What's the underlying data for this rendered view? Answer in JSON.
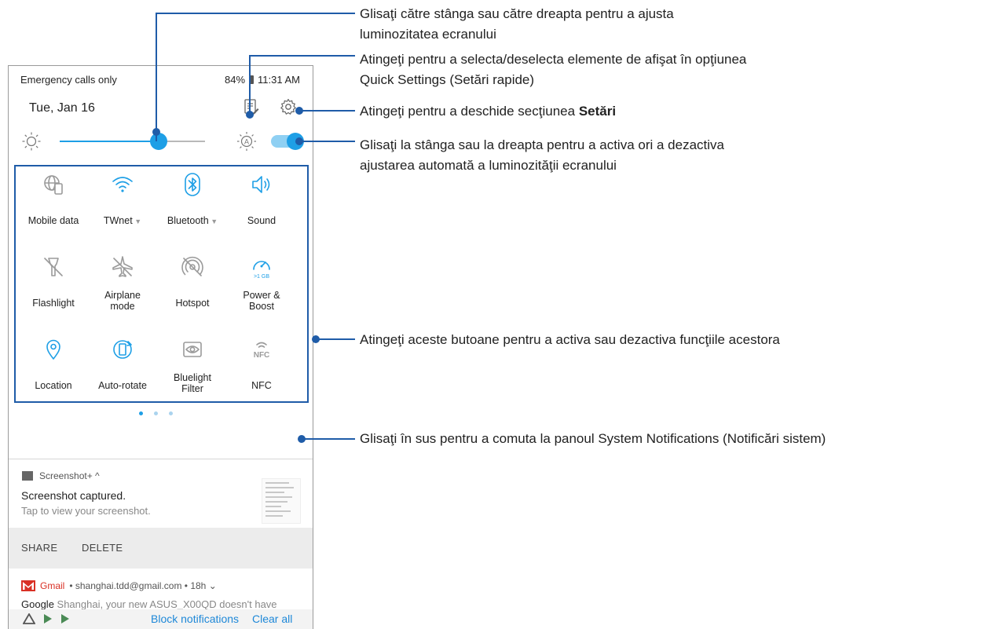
{
  "status": {
    "left": "Emergency calls only",
    "battery": "84%",
    "time": "11:31 AM"
  },
  "header": {
    "date": "Tue, Jan 16"
  },
  "brightness": {
    "level": 0.68,
    "auto": true
  },
  "tiles": [
    {
      "label1": "Mobile data",
      "label2": "",
      "caret": false,
      "icon": "globe-phone-icon",
      "active": false
    },
    {
      "label1": "TWnet",
      "label2": "",
      "caret": true,
      "icon": "wifi-icon",
      "active": true
    },
    {
      "label1": "Bluetooth",
      "label2": "",
      "caret": true,
      "icon": "bluetooth-icon",
      "active": true
    },
    {
      "label1": "Sound",
      "label2": "",
      "caret": false,
      "icon": "speaker-icon",
      "active": true
    },
    {
      "label1": "Flashlight",
      "label2": "",
      "caret": false,
      "icon": "flashlight-icon",
      "active": false
    },
    {
      "label1": "Airplane",
      "label2": "mode",
      "caret": false,
      "icon": "airplane-icon",
      "active": false
    },
    {
      "label1": "Hotspot",
      "label2": "",
      "caret": false,
      "icon": "hotspot-icon",
      "active": false
    },
    {
      "label1": "Power &",
      "label2": "Boost",
      "caret": false,
      "icon": "speedometer-icon",
      "active": true
    },
    {
      "label1": "Location",
      "label2": "",
      "caret": false,
      "icon": "location-pin-icon",
      "active": true
    },
    {
      "label1": "Auto-rotate",
      "label2": "",
      "caret": false,
      "icon": "rotate-icon",
      "active": true
    },
    {
      "label1": "Bluelight",
      "label2": "Filter",
      "caret": false,
      "icon": "eye-icon",
      "active": false
    },
    {
      "label1": "NFC",
      "label2": "",
      "caret": false,
      "icon": "nfc-icon",
      "active": false
    }
  ],
  "boost_badge": ">1 GB",
  "nfc_glyph": "NFC",
  "pager": {
    "pages": 3,
    "current": 1
  },
  "notification": {
    "app": "Screenshot+ ^",
    "title": "Screenshot captured.",
    "text": "Tap to view your screenshot.",
    "share": "SHARE",
    "delete": "DELETE"
  },
  "gmail": {
    "app": "Gmail",
    "meta": "• shanghai.tdd@gmail.com • 18h ⌄",
    "preview_bold": "Google",
    "preview_rest": " Shanghai, your new ASUS_X00QD doesn't have"
  },
  "footer": {
    "block": "Block notifications",
    "clear": "Clear all"
  },
  "annotations": {
    "brightness_1": "Glisaţi către stânga sau către dreapta pentru a ajusta",
    "brightness_2": "luminozitatea ecranului",
    "edit_1": "Atingeţi pentru a selecta/deselecta elemente de afişat în opţiunea",
    "edit_2": "Quick Settings (Setări rapide)",
    "settings_pre": "Atingeţi pentru a deschide secţiunea ",
    "settings_bold": "Setări",
    "auto_1": "Glisaţi la stânga sau la dreapta pentru a activa ori a dezactiva",
    "auto_2": "ajustarea automată a luminozităţii ecranului",
    "tiles": "Atingeţi aceste butoane pentru a activa sau dezactiva funcţiile acestora",
    "swipe": "Glisaţi în sus pentru a comuta la panoul System Notifications (Notificări sistem)"
  },
  "colors": {
    "accent": "#1e9fe6",
    "callout": "#1f5ca8",
    "gmail": "#d93025",
    "link": "#1e88d8"
  }
}
